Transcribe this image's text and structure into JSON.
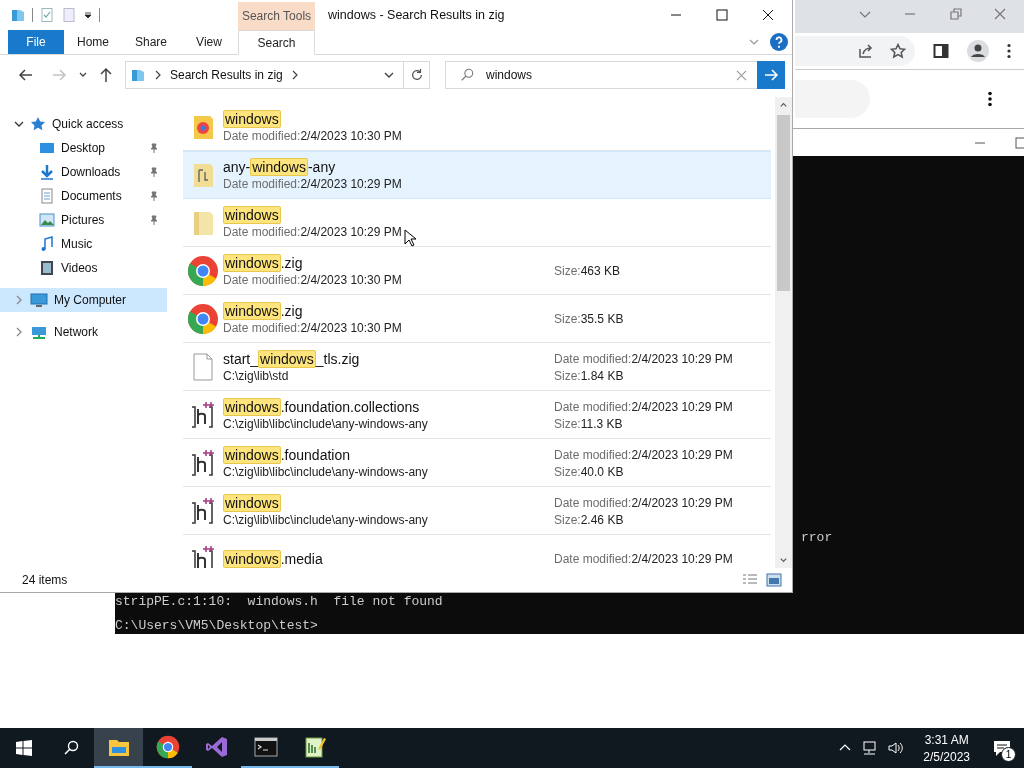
{
  "console_window": {
    "lines": [
      {
        "text": "rror",
        "kind": "tail"
      },
      {
        "text": "stripPE.c:1:10:  windows.h  file not found",
        "kind": "line"
      },
      {
        "text": "C:\\Users\\VM5\\Desktop\\test>",
        "kind": "line"
      }
    ]
  },
  "explorer": {
    "title": "windows - Search Results in zig",
    "context_tab": "Search Tools",
    "ribbon_tabs": [
      {
        "label": "File",
        "kind": "file",
        "selected": false
      },
      {
        "label": "Home",
        "kind": "tab",
        "selected": false
      },
      {
        "label": "Share",
        "kind": "tab",
        "selected": false
      },
      {
        "label": "View",
        "kind": "tab",
        "selected": false
      },
      {
        "label": "Search",
        "kind": "context",
        "selected": true
      }
    ],
    "nav_buttons": [
      {
        "kind": "back",
        "disabled": false
      },
      {
        "kind": "forward",
        "disabled": true
      },
      {
        "kind": "recent",
        "disabled": false
      },
      {
        "kind": "up",
        "disabled": false
      }
    ],
    "address": {
      "crumbs": [
        "Search Results in zig"
      ]
    },
    "search": {
      "value": "windows"
    },
    "sidebar": [
      {
        "label": "Quick access",
        "kind": "star",
        "expanded": true,
        "selected": false,
        "children": [
          {
            "label": "Desktop",
            "kind": "desktop",
            "pinned": true
          },
          {
            "label": "Downloads",
            "kind": "downloads",
            "pinned": true
          },
          {
            "label": "Documents",
            "kind": "documents",
            "pinned": true
          },
          {
            "label": "Pictures",
            "kind": "pictures",
            "pinned": true
          },
          {
            "label": "Music",
            "kind": "music",
            "pinned": false
          },
          {
            "label": "Videos",
            "kind": "videos",
            "pinned": false
          }
        ]
      },
      {
        "label": "My Computer",
        "kind": "computer",
        "expanded": false,
        "selected": true
      },
      {
        "label": "Network",
        "kind": "network",
        "expanded": false,
        "selected": false
      }
    ],
    "results": [
      {
        "kind": "chrome-folder",
        "selected": false,
        "name": [
          {
            "text": "windows",
            "match": true
          }
        ],
        "detail": {
          "label": "Date modified:",
          "value": "2/4/2023 10:30 PM"
        }
      },
      {
        "kind": "file-folder",
        "selected": true,
        "name": [
          {
            "text": "any-",
            "match": false
          },
          {
            "text": "windows",
            "match": true
          },
          {
            "text": "-any",
            "match": false
          }
        ],
        "detail": {
          "label": "Date modified:",
          "value": "2/4/2023 10:29 PM"
        }
      },
      {
        "kind": "folder",
        "selected": false,
        "name": [
          {
            "text": "windows",
            "match": true
          }
        ],
        "detail": {
          "label": "Date modified:",
          "value": "2/4/2023 10:29 PM"
        }
      },
      {
        "kind": "chrome",
        "selected": false,
        "name": [
          {
            "text": "windows",
            "match": true
          },
          {
            "text": ".zig",
            "match": false
          }
        ],
        "detail": {
          "label": "Date modified:",
          "value": "2/4/2023 10:30 PM"
        },
        "right": [
          {
            "label": "Size:",
            "value": "463 KB"
          }
        ]
      },
      {
        "kind": "chrome",
        "selected": false,
        "name": [
          {
            "text": "windows",
            "match": true
          },
          {
            "text": ".zig",
            "match": false
          }
        ],
        "detail": {
          "label": "Date modified:",
          "value": "2/4/2023 10:30 PM"
        },
        "right": [
          {
            "label": "Size:",
            "value": "35.5 KB"
          }
        ]
      },
      {
        "kind": "file",
        "selected": false,
        "name": [
          {
            "text": "start_",
            "match": false
          },
          {
            "text": "windows",
            "match": true
          },
          {
            "text": "_tls.zig",
            "match": false
          }
        ],
        "detail": {
          "value": "C:\\zig\\lib\\std"
        },
        "right": [
          {
            "label": "Date modified:",
            "value": "2/4/2023 10:29 PM"
          },
          {
            "label": "Size:",
            "value": "1.84 KB"
          }
        ]
      },
      {
        "kind": "header",
        "selected": false,
        "name": [
          {
            "text": "windows",
            "match": true
          },
          {
            "text": ".foundation.collections",
            "match": false
          }
        ],
        "detail": {
          "value": "C:\\zig\\lib\\libc\\include\\any-windows-any"
        },
        "right": [
          {
            "label": "Date modified:",
            "value": "2/4/2023 10:29 PM"
          },
          {
            "label": "Size:",
            "value": "11.3 KB"
          }
        ]
      },
      {
        "kind": "header",
        "selected": false,
        "name": [
          {
            "text": "windows",
            "match": true
          },
          {
            "text": ".foundation",
            "match": false
          }
        ],
        "detail": {
          "value": "C:\\zig\\lib\\libc\\include\\any-windows-any"
        },
        "right": [
          {
            "label": "Date modified:",
            "value": "2/4/2023 10:29 PM"
          },
          {
            "label": "Size:",
            "value": "40.0 KB"
          }
        ]
      },
      {
        "kind": "header",
        "selected": false,
        "name": [
          {
            "text": "windows",
            "match": true
          }
        ],
        "detail": {
          "value": "C:\\zig\\lib\\libc\\include\\any-windows-any"
        },
        "right": [
          {
            "label": "Date modified:",
            "value": "2/4/2023 10:29 PM"
          },
          {
            "label": "Size:",
            "value": "2.46 KB"
          }
        ]
      },
      {
        "kind": "header",
        "selected": false,
        "name": [
          {
            "text": "windows",
            "match": true
          },
          {
            "text": ".media",
            "match": false
          }
        ],
        "right": [
          {
            "label": "Date modified:",
            "value": "2/4/2023 10:29 PM"
          }
        ]
      }
    ],
    "status": {
      "count": "24 items"
    }
  },
  "taskbar": {
    "apps": [
      {
        "kind": "explorer",
        "running": true,
        "selected": true
      },
      {
        "kind": "chrome",
        "running": true,
        "selected": false
      },
      {
        "kind": "visual-studio",
        "running": false,
        "selected": false
      },
      {
        "kind": "terminal",
        "running": true,
        "selected": false
      },
      {
        "kind": "notepad",
        "running": true,
        "selected": false
      }
    ],
    "time": "3:31 AM",
    "date": "2/5/2023",
    "notification_count": "1"
  }
}
